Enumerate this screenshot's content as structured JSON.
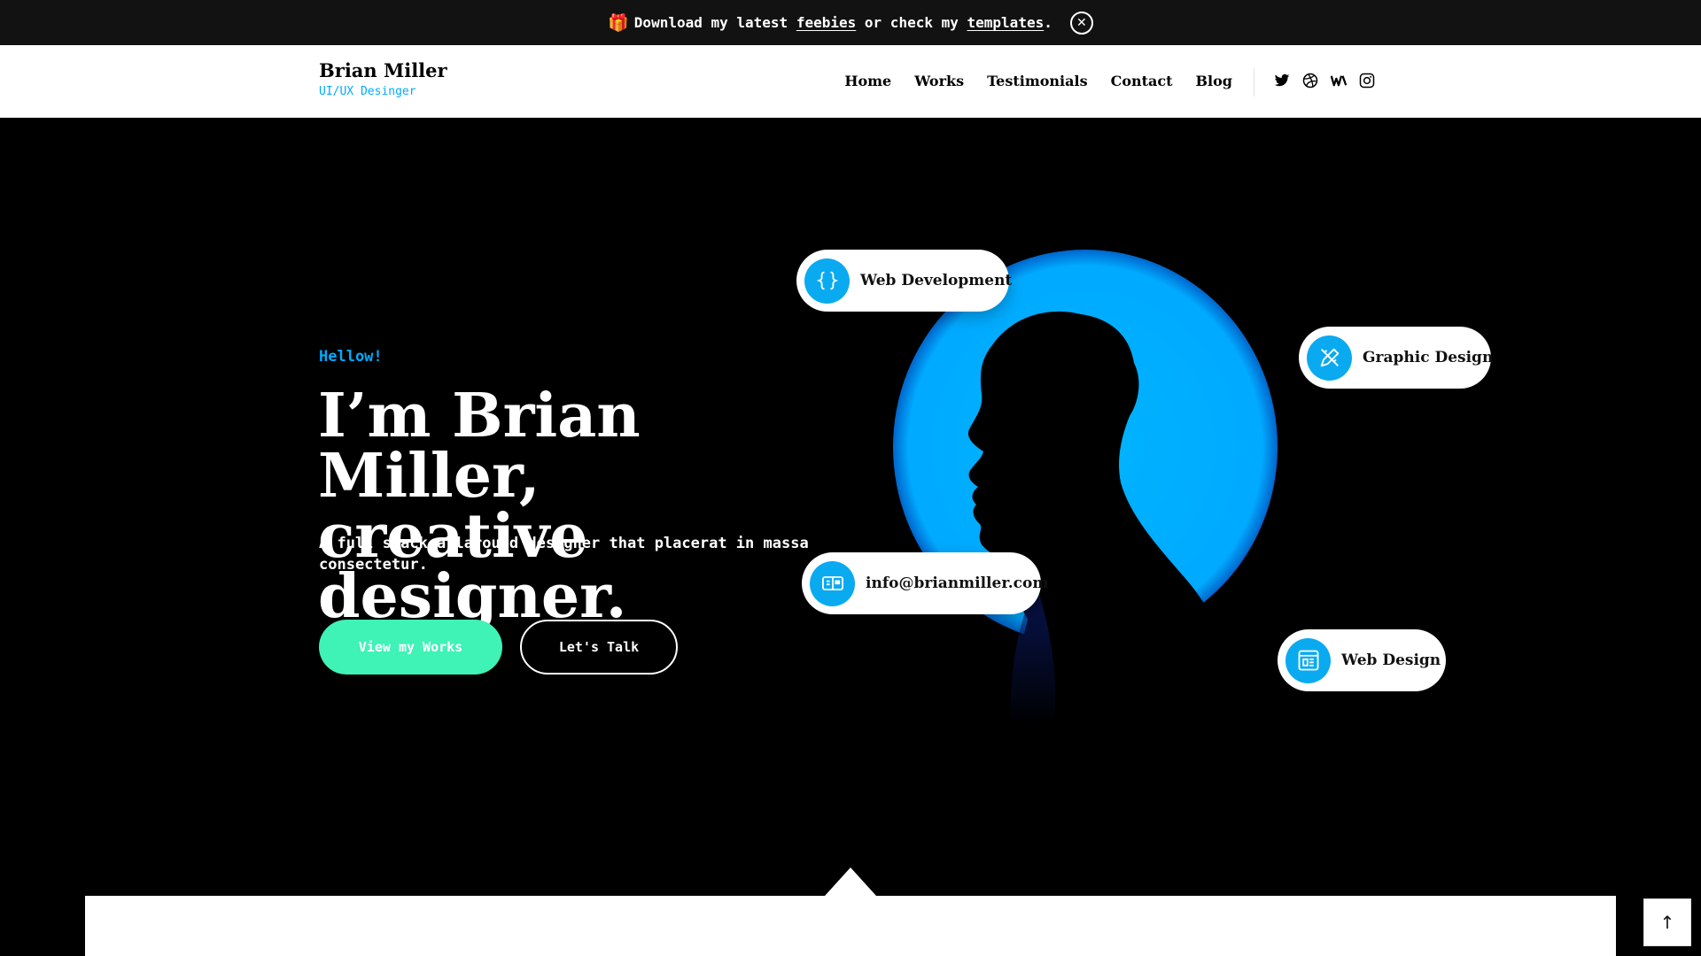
{
  "announcement": {
    "text_1": "Download my latest",
    "link_feebies": "feebies",
    "text_2": "or check my",
    "link_templates": "templates",
    "text_3": ".",
    "close_icon": "close-icon",
    "gift_icon": "gift-icon"
  },
  "header": {
    "brand_name": "Brian Miller",
    "brand_role": "UI/UX Desinger",
    "nav": [
      "Home",
      "Works",
      "Testimonials",
      "Contact",
      "Blog"
    ],
    "socials": [
      "twitter-icon",
      "dribbble-icon",
      "wix-icon",
      "instagram-icon"
    ]
  },
  "hero": {
    "greeting": "Hellow!",
    "headline_line1": "I’m Brian Miller,",
    "headline_line2": "creative designer.",
    "subtext": "A full stack allaround designer that placerat in massa consectetur.",
    "primary_button": "View my Works",
    "secondary_button": "Let's Talk"
  },
  "chips": {
    "web_development": "Web Development",
    "graphic_design": "Graphic Design",
    "email": "info@brianmiller.com",
    "web_design": "Web Design"
  },
  "colors": {
    "accent_blue": "#00aaff",
    "accent_mint": "#3ff2b5",
    "announcement_bg": "#121212"
  }
}
